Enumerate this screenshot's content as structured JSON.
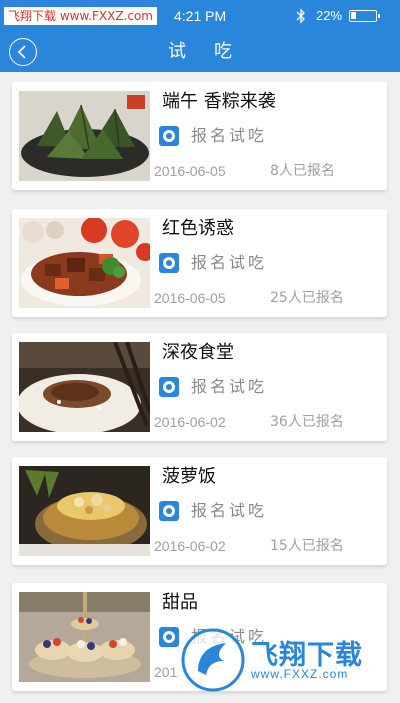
{
  "status_bar": {
    "watermark": "飞翔下载 www.FXXZ.com",
    "time": "4:21 PM",
    "battery_pct": "22%",
    "battery_level": 0.22
  },
  "nav": {
    "title": "试吃",
    "back_icon": "chevron-left-icon"
  },
  "items": [
    {
      "title": "端午 香粽来袭",
      "sign_label": "报名试吃",
      "date": "2016-06-05",
      "count": "8人已报名",
      "image": "zongzi"
    },
    {
      "title": "红色诱惑",
      "sign_label": "报名试吃",
      "date": "2016-06-05",
      "count": "25人已报名",
      "image": "braised-meat"
    },
    {
      "title": "深夜食堂",
      "sign_label": "报名试吃",
      "date": "2016-06-02",
      "count": "36人已报名",
      "image": "rice-bowl"
    },
    {
      "title": "菠萝饭",
      "sign_label": "报名试吃",
      "date": "2016-06-02",
      "count": "15人已报名",
      "image": "pineapple-rice"
    },
    {
      "title": "甜品",
      "sign_label": "报名试吃",
      "date": "201",
      "count": "",
      "image": "dessert-tarts"
    }
  ],
  "watermark": {
    "brand": "飞翔下载",
    "url": "www.FXXZ.com"
  },
  "colors": {
    "accent": "#2a86db",
    "background": "#f0f0f0"
  }
}
